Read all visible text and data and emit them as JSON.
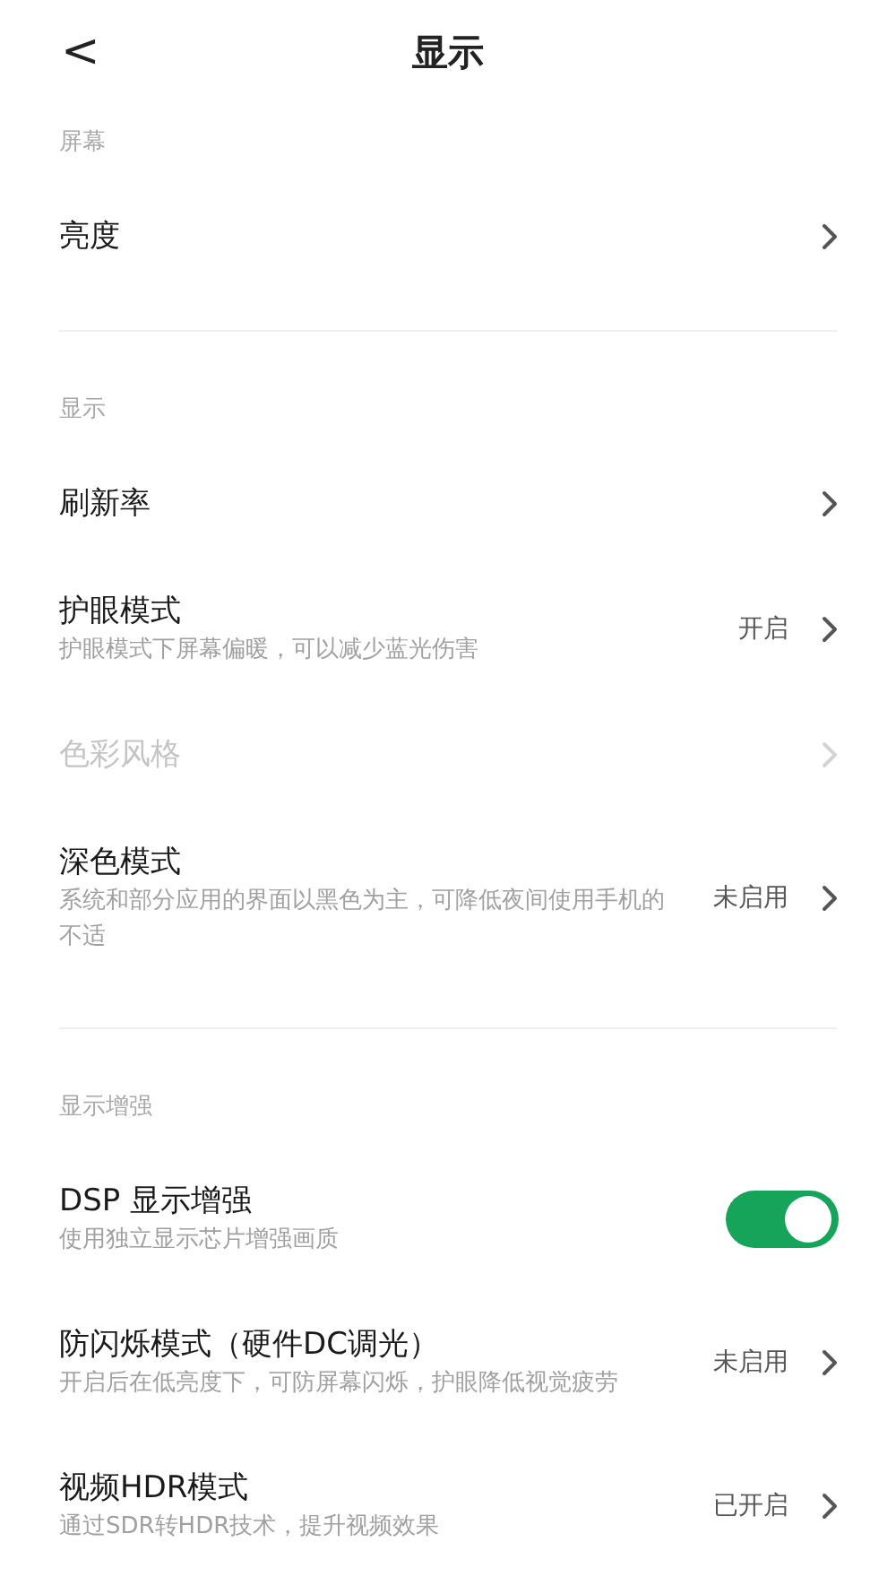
{
  "header": {
    "back": "<",
    "title": "显示"
  },
  "sections": [
    {
      "heading": "屏幕",
      "items": [
        {
          "kind": "link",
          "title": "亮度",
          "disabled": false
        }
      ]
    },
    {
      "heading": "显示",
      "items": [
        {
          "kind": "link",
          "title": "刷新率",
          "disabled": false
        },
        {
          "kind": "link",
          "title": "护眼模式",
          "description": "护眼模式下屏幕偏暖，可以减少蓝光伤害",
          "value": "开启",
          "disabled": false
        },
        {
          "kind": "link",
          "title": "色彩风格",
          "disabled": true
        },
        {
          "kind": "link",
          "title": "深色模式",
          "description": "系统和部分应用的界面以黑色为主，可降低夜间使用手机的不适",
          "value": "未启用",
          "disabled": false
        }
      ]
    },
    {
      "heading": "显示增强",
      "items": [
        {
          "kind": "toggle",
          "title": "DSP 显示增强",
          "description": "使用独立显示芯片增强画质",
          "on": true,
          "disabled": false
        },
        {
          "kind": "link",
          "title": "防闪烁模式（硬件DC调光）",
          "description": "开启后在低亮度下，可防屏幕闪烁，护眼降低视觉疲劳",
          "value": "未启用",
          "disabled": false
        },
        {
          "kind": "link",
          "title": "视频HDR模式",
          "description": "通过SDR转HDR技术，提升视频效果",
          "value": "已开启",
          "disabled": false
        }
      ]
    }
  ]
}
